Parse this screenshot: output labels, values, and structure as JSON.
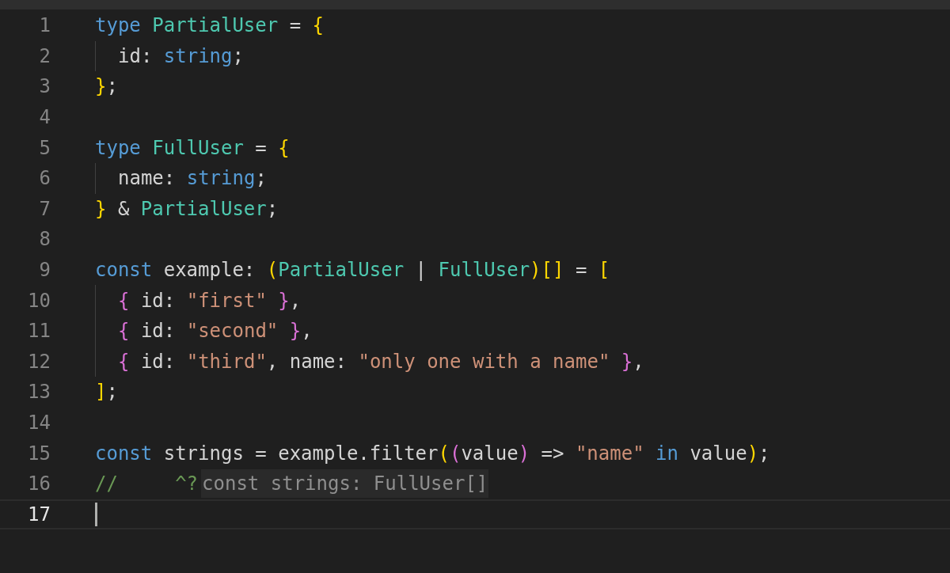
{
  "editor": {
    "lines": [
      {
        "number": "1",
        "indented": false,
        "current": false,
        "tokens": [
          {
            "text": "type ",
            "kind": "keyword"
          },
          {
            "text": "PartialUser",
            "kind": "type"
          },
          {
            "text": " = ",
            "kind": "plain"
          },
          {
            "text": "{",
            "kind": "brace1"
          }
        ]
      },
      {
        "number": "2",
        "indented": true,
        "current": false,
        "tokens": [
          {
            "text": "id: ",
            "kind": "plain"
          },
          {
            "text": "string",
            "kind": "keyword"
          },
          {
            "text": ";",
            "kind": "plain"
          }
        ]
      },
      {
        "number": "3",
        "indented": false,
        "current": false,
        "tokens": [
          {
            "text": "}",
            "kind": "brace1"
          },
          {
            "text": ";",
            "kind": "plain"
          }
        ]
      },
      {
        "number": "4",
        "indented": false,
        "current": false
      },
      {
        "number": "5",
        "indented": false,
        "current": false,
        "tokens": [
          {
            "text": "type ",
            "kind": "keyword"
          },
          {
            "text": "FullUser",
            "kind": "type"
          },
          {
            "text": " = ",
            "kind": "plain"
          },
          {
            "text": "{",
            "kind": "brace1"
          }
        ]
      },
      {
        "number": "6",
        "indented": true,
        "current": false,
        "tokens": [
          {
            "text": "name: ",
            "kind": "plain"
          },
          {
            "text": "string",
            "kind": "keyword"
          },
          {
            "text": ";",
            "kind": "plain"
          }
        ]
      },
      {
        "number": "7",
        "indented": false,
        "current": false,
        "tokens": [
          {
            "text": "}",
            "kind": "brace1"
          },
          {
            "text": " & ",
            "kind": "plain"
          },
          {
            "text": "PartialUser",
            "kind": "type"
          },
          {
            "text": ";",
            "kind": "plain"
          }
        ]
      },
      {
        "number": "8",
        "indented": false,
        "current": false
      },
      {
        "number": "9",
        "indented": false,
        "current": false,
        "tokens": [
          {
            "text": "const ",
            "kind": "keyword"
          },
          {
            "text": "example: ",
            "kind": "plain"
          },
          {
            "text": "(",
            "kind": "brace1"
          },
          {
            "text": "PartialUser",
            "kind": "type"
          },
          {
            "text": " | ",
            "kind": "plain"
          },
          {
            "text": "FullUser",
            "kind": "type"
          },
          {
            "text": ")",
            "kind": "brace1"
          },
          {
            "text": "[]",
            "kind": "brace1"
          },
          {
            "text": " = ",
            "kind": "plain"
          },
          {
            "text": "[",
            "kind": "brace1"
          }
        ]
      },
      {
        "number": "10",
        "indented": true,
        "current": false,
        "tokens": [
          {
            "text": "{ ",
            "kind": "brace2"
          },
          {
            "text": "id: ",
            "kind": "plain"
          },
          {
            "text": "\"first\"",
            "kind": "string"
          },
          {
            "text": " }",
            "kind": "brace2"
          },
          {
            "text": ",",
            "kind": "plain"
          }
        ]
      },
      {
        "number": "11",
        "indented": true,
        "current": false,
        "tokens": [
          {
            "text": "{ ",
            "kind": "brace2"
          },
          {
            "text": "id: ",
            "kind": "plain"
          },
          {
            "text": "\"second\"",
            "kind": "string"
          },
          {
            "text": " }",
            "kind": "brace2"
          },
          {
            "text": ",",
            "kind": "plain"
          }
        ]
      },
      {
        "number": "12",
        "indented": true,
        "current": false,
        "tokens": [
          {
            "text": "{ ",
            "kind": "brace2"
          },
          {
            "text": "id: ",
            "kind": "plain"
          },
          {
            "text": "\"third\"",
            "kind": "string"
          },
          {
            "text": ", name: ",
            "kind": "plain"
          },
          {
            "text": "\"only one with a name\"",
            "kind": "string"
          },
          {
            "text": " }",
            "kind": "brace2"
          },
          {
            "text": ",",
            "kind": "plain"
          }
        ]
      },
      {
        "number": "13",
        "indented": false,
        "current": false,
        "tokens": [
          {
            "text": "]",
            "kind": "brace1"
          },
          {
            "text": ";",
            "kind": "plain"
          }
        ]
      },
      {
        "number": "14",
        "indented": false,
        "current": false
      },
      {
        "number": "15",
        "indented": false,
        "current": false,
        "tokens": [
          {
            "text": "const ",
            "kind": "keyword"
          },
          {
            "text": "strings = example.filter",
            "kind": "plain"
          },
          {
            "text": "(",
            "kind": "brace1"
          },
          {
            "text": "(",
            "kind": "brace2"
          },
          {
            "text": "value",
            "kind": "plain"
          },
          {
            "text": ")",
            "kind": "brace2"
          },
          {
            "text": " => ",
            "kind": "plain"
          },
          {
            "text": "\"name\"",
            "kind": "string"
          },
          {
            "text": " in ",
            "kind": "keyword"
          },
          {
            "text": "value",
            "kind": "plain"
          },
          {
            "text": ")",
            "kind": "brace1"
          },
          {
            "text": ";",
            "kind": "plain"
          }
        ]
      },
      {
        "number": "16",
        "indented": false,
        "current": false,
        "tokens": [
          {
            "text": "//     ^?",
            "kind": "comment"
          }
        ],
        "inlay_hint": "const strings: FullUser[]"
      },
      {
        "number": "17",
        "indented": false,
        "current": true
      }
    ]
  }
}
